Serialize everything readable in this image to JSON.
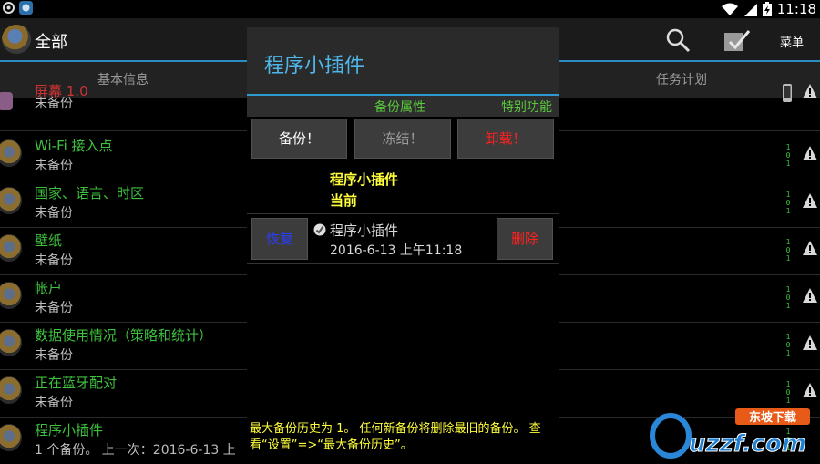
{
  "status_bar": {
    "time": "11:18"
  },
  "action_bar": {
    "title": "全部",
    "menu_label": "菜单"
  },
  "tabs": [
    {
      "label": "基本信息"
    },
    {
      "label": "任务计划"
    }
  ],
  "list": [
    {
      "title": "屏幕 1.0",
      "subtitle": "未备份"
    },
    {
      "title": "Wi-Fi 接入点",
      "subtitle": "未备份",
      "bin": [
        "1",
        "0",
        "1"
      ]
    },
    {
      "title": "国家、语言、时区",
      "subtitle": "未备份",
      "bin": [
        "1",
        "0",
        "1"
      ]
    },
    {
      "title": "壁纸",
      "subtitle": "未备份",
      "bin": [
        "1",
        "0",
        "1"
      ]
    },
    {
      "title": "帐户",
      "subtitle": "未备份",
      "bin": [
        "1",
        "0",
        "1"
      ]
    },
    {
      "title": "数据使用情况（策略和统计）",
      "subtitle": "未备份",
      "bin": [
        "1",
        "0",
        "1"
      ]
    },
    {
      "title": "正在蓝牙配对",
      "subtitle": "未备份",
      "bin": [
        "1",
        "0",
        "1"
      ]
    },
    {
      "title": "程序小插件",
      "subtitle": "1 个备份。 上一次：2016-6-13 上",
      "bin": [
        "1",
        "0",
        "1"
      ]
    }
  ],
  "dialog": {
    "title": "程序小插件",
    "tabs": [
      "备份属性",
      "特别功能"
    ],
    "actions": {
      "backup": {
        "label": "备份！",
        "color": "#ffffff"
      },
      "freeze": {
        "label": "冻结！",
        "color": "#9a9a9a"
      },
      "uninstall": {
        "label": "卸载！",
        "color": "#ff2020"
      }
    },
    "app_name": "程序小插件",
    "state": "当前",
    "backup_entry": {
      "restore_label": "恢复",
      "name": "程序小插件",
      "date": "2016-6-13 上午11:18",
      "delete_label": "删除"
    },
    "footnote": "最大备份历史为 1。 任何新备份将删除最旧的备份。 查看“设置”=>“最大备份历史”。"
  },
  "watermark": {
    "text": "uzzf.com",
    "tagline": "东坡下载"
  },
  "colors": {
    "accent": "#2c8bc0",
    "green": "#3ec13e",
    "yellow": "#ffff3c",
    "red": "#ff2020"
  }
}
